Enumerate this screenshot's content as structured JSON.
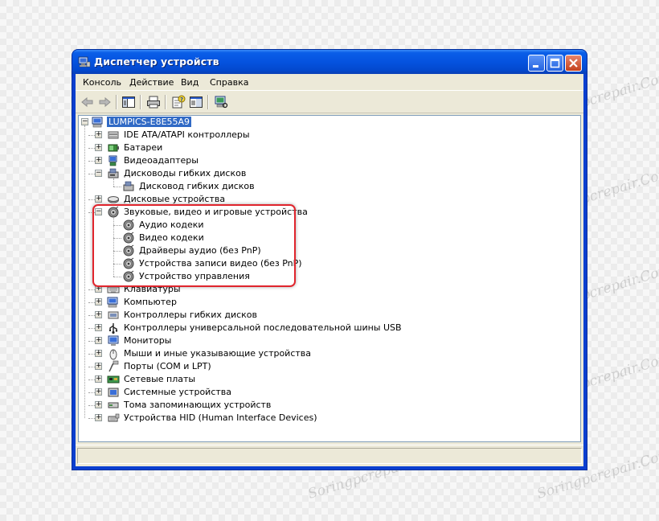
{
  "window": {
    "title": "Диспетчер устройств",
    "accent": "#0553df",
    "title_icon": "device-manager-icon"
  },
  "menu": [
    "Консоль",
    "Действие",
    "Вид",
    "Справка"
  ],
  "toolbar": [
    "back-arrow-icon",
    "forward-arrow-icon",
    "show-hide-tree-icon",
    "print-icon",
    "properties-help-icon",
    "details-icon",
    "scan-hardware-icon"
  ],
  "tree": {
    "root": "LUMPICS-E8E55A9",
    "categories": [
      {
        "label": "IDE ATA/ATAPI контроллеры",
        "icon": "ide-controller-icon",
        "expanded": false
      },
      {
        "label": "Батареи",
        "icon": "battery-icon",
        "expanded": false
      },
      {
        "label": "Видеоадаптеры",
        "icon": "display-adapter-icon",
        "expanded": false
      },
      {
        "label": "Дисководы гибких дисков",
        "icon": "floppy-drive-icon",
        "expanded": true,
        "children": [
          "Дисковод гибких дисков"
        ]
      },
      {
        "label": "Дисковые устройства",
        "icon": "disk-drive-icon",
        "expanded": false
      },
      {
        "label": "Звуковые, видео и игровые устройства",
        "icon": "sound-icon",
        "expanded": true,
        "children": [
          "Аудио кодеки",
          "Видео кодеки",
          "Драйверы аудио (без PnP)",
          "Устройства записи видео (без PnP)",
          "Устройство управления"
        ]
      },
      {
        "label": "Клавиатуры",
        "icon": "keyboard-icon",
        "expanded": false
      },
      {
        "label": "Компьютер",
        "icon": "computer-icon",
        "expanded": false
      },
      {
        "label": "Контроллеры гибких дисков",
        "icon": "floppy-controller-icon",
        "expanded": false
      },
      {
        "label": "Контроллеры универсальной последовательной шины USB",
        "icon": "usb-icon",
        "expanded": false
      },
      {
        "label": "Мониторы",
        "icon": "monitor-icon",
        "expanded": false
      },
      {
        "label": "Мыши и иные указывающие устройства",
        "icon": "mouse-icon",
        "expanded": false
      },
      {
        "label": "Порты (COM и LPT)",
        "icon": "port-icon",
        "expanded": false
      },
      {
        "label": "Сетевые платы",
        "icon": "network-card-icon",
        "expanded": false
      },
      {
        "label": "Системные устройства",
        "icon": "system-device-icon",
        "expanded": false
      },
      {
        "label": "Тома запоминающих устройств",
        "icon": "storage-volume-icon",
        "expanded": false
      },
      {
        "label": "Устройства HID (Human Interface Devices)",
        "icon": "hid-icon",
        "expanded": false
      }
    ]
  },
  "highlight_color": "#e0252d",
  "watermark": "Soringpcrepair.Com"
}
